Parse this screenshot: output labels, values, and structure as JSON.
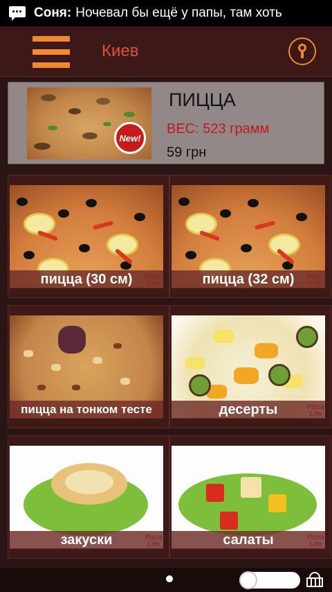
{
  "notification": {
    "sender": "Соня:",
    "message": "Ночевал бы ещё у папы, там хоть"
  },
  "topbar": {
    "city": "Киев",
    "menu_icon": "hamburger-icon",
    "location_icon": "location-pin-icon",
    "accent_color": "#f18a2e",
    "city_color": "#d9533c"
  },
  "promo": {
    "badge": "New!",
    "title": "ПИЦЦА",
    "weight": "ВЕС: 523 грамм",
    "price": "59 грн"
  },
  "categories": [
    {
      "label": "пицца (30 см)"
    },
    {
      "label": "пицца (32 см)"
    },
    {
      "label": "пицца на тонком тесте"
    },
    {
      "label": "десерты"
    },
    {
      "label": "закуски"
    },
    {
      "label": "салаты"
    }
  ],
  "brand_logo": "Pizza Life",
  "bottombar": {
    "pager": {
      "pages": 2,
      "active": 2
    },
    "toggle_icon": "toggle-switch-icon",
    "basket_icon": "basket-icon"
  }
}
